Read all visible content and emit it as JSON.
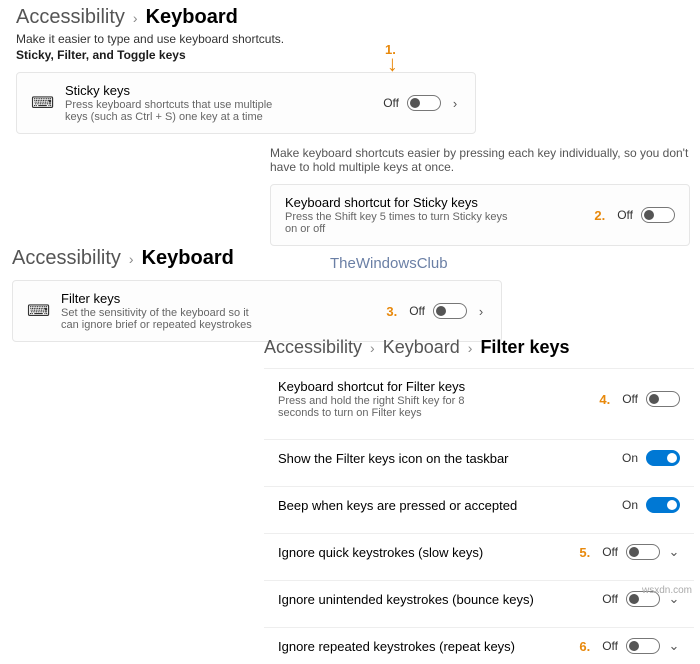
{
  "watermark": "TheWindowsClub",
  "source": "wsxdn.com",
  "numbers": {
    "n1": "1.",
    "n2": "2.",
    "n3": "3.",
    "n4": "4.",
    "n5": "5.",
    "n6": "6."
  },
  "sec1": {
    "bc": {
      "link": "Accessibility",
      "here": "Keyboard"
    },
    "sub": "Make it easier to type and use keyboard shortcuts.",
    "sub2": "Sticky, Filter, and Toggle keys",
    "card": {
      "title": "Sticky keys",
      "desc": "Press keyboard shortcuts that use multiple keys (such as Ctrl + S) one key at a time",
      "state": "Off"
    }
  },
  "sec2": {
    "intro": "Make keyboard shortcuts easier by pressing each key individually, so you don't have to hold multiple keys at once.",
    "card": {
      "title": "Keyboard shortcut for Sticky keys",
      "desc": "Press the Shift key 5 times to turn Sticky keys on or off",
      "state": "Off"
    }
  },
  "sec3": {
    "bc": {
      "link": "Accessibility",
      "here": "Keyboard"
    },
    "card": {
      "title": "Filter keys",
      "desc": "Set the sensitivity of the keyboard so it can ignore brief or repeated keystrokes",
      "state": "Off"
    }
  },
  "sec4": {
    "bc": {
      "link": "Accessibility",
      "mid": "Keyboard",
      "here": "Filter keys"
    },
    "rows": [
      {
        "title": "Keyboard shortcut for Filter keys",
        "desc": "Press and hold the right Shift key for 8 seconds to turn on Filter keys",
        "state": "Off",
        "num": "n4",
        "chev": false
      },
      {
        "title": "Show the Filter keys icon on the taskbar",
        "desc": "",
        "state": "On",
        "num": "",
        "chev": false
      },
      {
        "title": "Beep when keys are pressed or accepted",
        "desc": "",
        "state": "On",
        "num": "",
        "chev": false
      },
      {
        "title": "Ignore quick keystrokes (slow keys)",
        "desc": "",
        "state": "Off",
        "num": "n5",
        "chev": true
      },
      {
        "title": "Ignore unintended keystrokes (bounce keys)",
        "desc": "",
        "state": "Off",
        "num": "",
        "chev": true
      },
      {
        "title": "Ignore repeated keystrokes (repeat keys)",
        "desc": "",
        "state": "Off",
        "num": "n6",
        "chev": true
      }
    ]
  }
}
